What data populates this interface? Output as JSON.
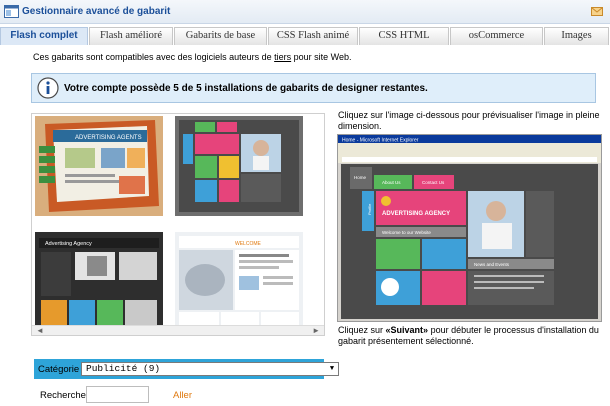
{
  "window": {
    "title": "Gestionnaire avancé de gabarit"
  },
  "tabs": [
    {
      "label": "Flash complet",
      "active": true
    },
    {
      "label": "Flash amélioré",
      "active": false
    },
    {
      "label": "Gabarits de base",
      "active": false
    },
    {
      "label": "CSS Flash animé",
      "active": false
    },
    {
      "label": "CSS HTML",
      "active": false
    },
    {
      "label": "osCommerce",
      "active": false
    },
    {
      "label": "Images",
      "active": false
    }
  ],
  "intro": {
    "before": "Ces gabarits sont compatibles avec des logiciels auteurs de ",
    "link": "tiers",
    "after": " pour site Web."
  },
  "notice": {
    "text": "Votre compte possède 5 de 5 installations de gabarits de designer restantes."
  },
  "thumbnails": [
    {
      "name": "template-advertising-agents",
      "heading": "ADVERTISING AGENTS"
    },
    {
      "name": "template-dark-tiles",
      "heading": ""
    },
    {
      "name": "template-advertising-agency-dark",
      "heading": "Advertising Agency"
    },
    {
      "name": "template-welcome-light",
      "heading": "WELCOME"
    }
  ],
  "gallery": {
    "scroll_left": "◄",
    "scroll_right": "►"
  },
  "category": {
    "label": "Catégorie",
    "selected": "Publicité (9)"
  },
  "search": {
    "label": "Recherche",
    "value": "",
    "go": "Aller"
  },
  "preview": {
    "caption": "Cliquez sur l'image ci-dessous pour prévisualiser l'image in pleine dimension.",
    "window_title": "Home - Microsoft Internet Explorer",
    "agency": "ADVERTISING AGENCY",
    "nav": [
      "Home",
      "About Us",
      "Contact Us"
    ],
    "side": "Profile",
    "welcome": "Welcome to our Website",
    "news": "News and Events"
  },
  "bottom_caption": {
    "before": "Cliquez sur ",
    "bold": "«Suivant»",
    "after": " pour débuter le processus d'installation du gabarit présentement sélectionné."
  },
  "colors": {
    "accent": "#2ea4d9",
    "link": "#e07a10",
    "title": "#1b4f99"
  }
}
